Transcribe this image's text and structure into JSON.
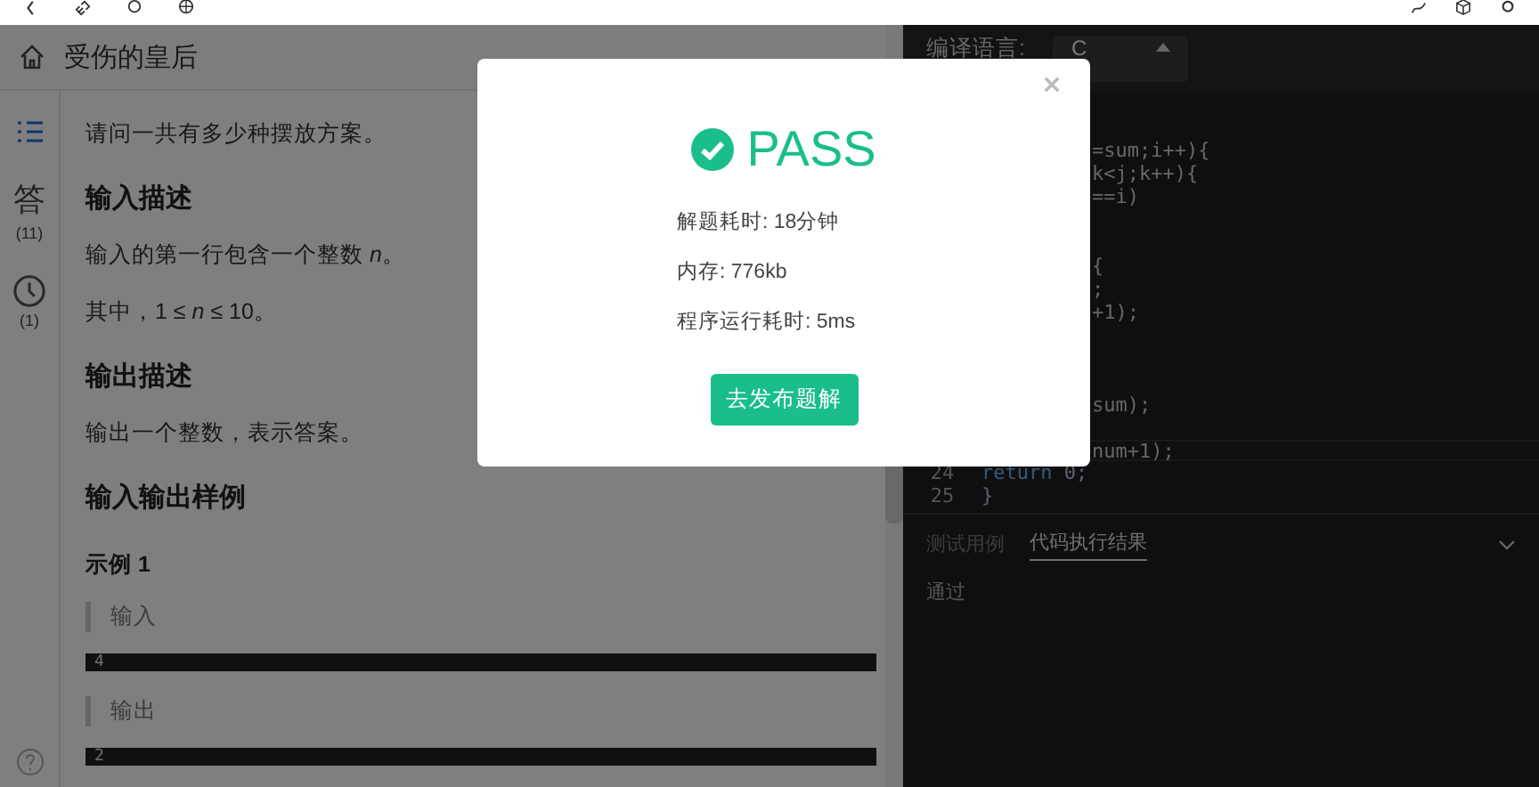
{
  "problem": {
    "title": "受伤的皇后"
  },
  "sidebar": {
    "items": [
      {
        "kind": "outline",
        "selected": true
      },
      {
        "kind": "answers",
        "label": "答",
        "count": "(11)",
        "selected": false
      },
      {
        "kind": "history",
        "count": "(1)",
        "selected": false
      }
    ]
  },
  "content": [
    {
      "kind": "text",
      "text": "请问一共有多少种摆放方案。"
    },
    {
      "kind": "heading",
      "text": "输入描述"
    },
    {
      "kind": "text",
      "text": "输入的第一行包含一个整数 *n*。"
    },
    {
      "kind": "text",
      "text": "其中，1 ≤ *n* ≤ 10。"
    },
    {
      "kind": "heading",
      "text": "输出描述"
    },
    {
      "kind": "text",
      "text": "输出一个整数，表示答案。"
    },
    {
      "kind": "heading",
      "text": "输入输出样例"
    },
    {
      "kind": "subheading",
      "text": "示例 1"
    },
    {
      "kind": "quote",
      "text": "输入"
    },
    {
      "kind": "sample",
      "text": "4"
    },
    {
      "kind": "quote",
      "text": "输出"
    },
    {
      "kind": "sample",
      "text": "2"
    }
  ],
  "editor": {
    "language_label": "编译语言:",
    "language": "C",
    "lines": [
      {
        "kind": "blank"
      },
      {
        "kind": "partial",
        "text": "=sum;i++){"
      },
      {
        "kind": "partial",
        "text": "k<j;k++){"
      },
      {
        "kind": "partial",
        "text": "==i)"
      },
      {
        "kind": "blank"
      },
      {
        "kind": "blank"
      },
      {
        "kind": "partial",
        "text": "{"
      },
      {
        "kind": "partial",
        "text": ";"
      },
      {
        "kind": "partial",
        "text": "+1);"
      },
      {
        "kind": "blank"
      },
      {
        "kind": "blank"
      },
      {
        "kind": "blank"
      },
      {
        "kind": "partial",
        "text": "sum);"
      },
      {
        "kind": "blank"
      },
      {
        "kind": "partial",
        "text": "num+1);",
        "current": true
      },
      {
        "kind": "full",
        "number": "24",
        "tokens": [
          {
            "kind": "keyword",
            "text": "return"
          },
          {
            "kind": "plain",
            "text": " 0;"
          }
        ]
      },
      {
        "kind": "full",
        "number": "25",
        "tokens": [
          {
            "kind": "plain",
            "text": "}"
          }
        ]
      }
    ]
  },
  "result_panel": {
    "tabs": [
      {
        "label": "测试用例",
        "selected": false
      },
      {
        "label": "代码执行结果",
        "selected": true
      }
    ],
    "output": "通过"
  },
  "dialog": {
    "status": "PASS",
    "stats": [
      "解题耗时: 18分钟",
      "内存: 776kb",
      "程序运行耗时: 5ms"
    ],
    "button": "去发布题解"
  }
}
